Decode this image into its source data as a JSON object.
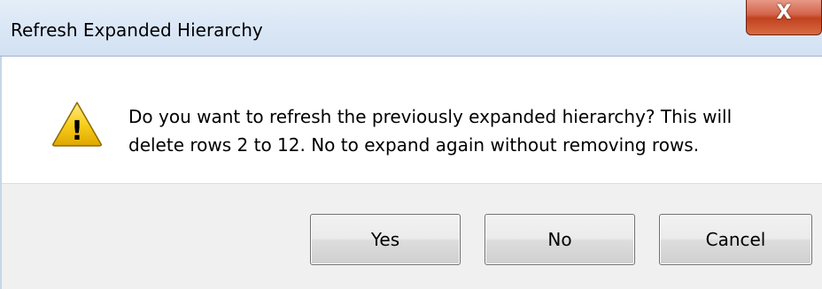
{
  "window": {
    "title": "Refresh Expanded Hierarchy",
    "close_glyph": "X"
  },
  "icon": {
    "semantic": "warning-icon",
    "glyph": "!"
  },
  "message": {
    "line1": "Do you want to refresh the previously expanded hierarchy? This will",
    "line2": "delete rows 2 to 12. No to expand again without removing rows."
  },
  "buttons": {
    "yes": "Yes",
    "no": "No",
    "cancel": "Cancel"
  },
  "colors": {
    "warning_fill": "#f5c400",
    "close_red": "#c1411f",
    "footer_bg": "#f0f0f0"
  }
}
